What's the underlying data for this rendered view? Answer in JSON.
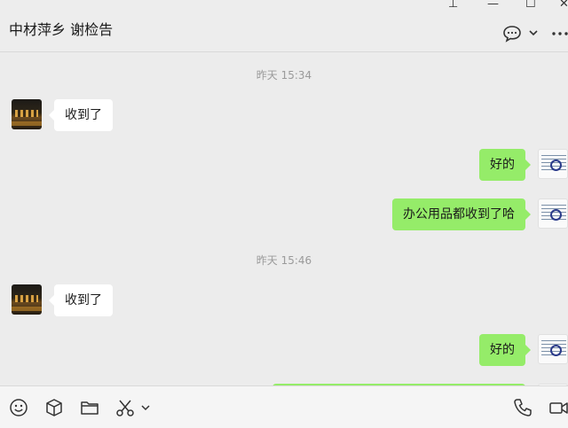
{
  "header": {
    "title": "中材萍乡 谢检告"
  },
  "window": {
    "pin": "⊥",
    "minimize": "—",
    "maximize": "☐",
    "close": "✕"
  },
  "messages": [
    {
      "kind": "time",
      "text": "昨天 15:34"
    },
    {
      "kind": "received",
      "text": "收到了"
    },
    {
      "kind": "sent",
      "text": "好的"
    },
    {
      "kind": "sent",
      "text": "办公用品都收到了哈"
    },
    {
      "kind": "time",
      "text": "昨天 15:46"
    },
    {
      "kind": "received",
      "text": "收到了"
    },
    {
      "kind": "sent",
      "text": "好的"
    }
  ],
  "toolbar": {
    "icons": [
      "emoji-icon",
      "package-icon",
      "folder-icon",
      "scissors-icon",
      "chevron-down-icon",
      "phone-icon",
      "video-icon"
    ]
  },
  "colors": {
    "sent_bubble": "#95ec69",
    "received_bubble": "#ffffff",
    "background": "#ececec"
  }
}
